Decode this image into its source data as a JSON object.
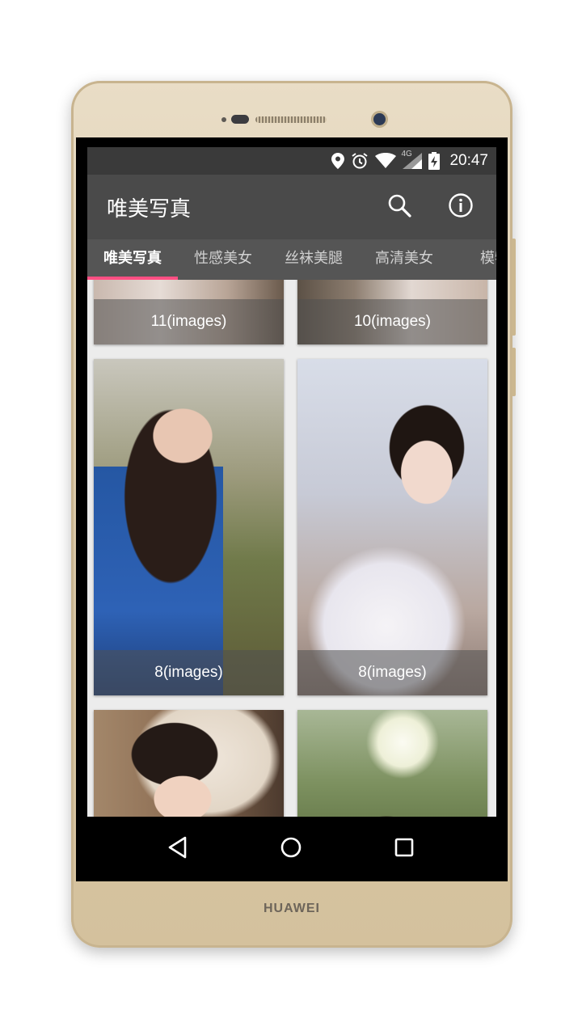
{
  "status_bar": {
    "time": "20:47",
    "network": "4G",
    "icons": [
      "location-icon",
      "alarm-icon",
      "wifi-icon",
      "signal-icon",
      "battery-icon"
    ]
  },
  "toolbar": {
    "title": "唯美写真",
    "actions": [
      "search-icon",
      "info-icon"
    ]
  },
  "tabs": [
    {
      "label": "唯美写真",
      "active": true
    },
    {
      "label": "性感美女",
      "active": false
    },
    {
      "label": "丝袜美腿",
      "active": false
    },
    {
      "label": "高清美女",
      "active": false
    },
    {
      "label": "模特",
      "active": false
    }
  ],
  "albums": [
    {
      "caption": "11(images)"
    },
    {
      "caption": "10(images)"
    },
    {
      "caption": "8(images)"
    },
    {
      "caption": "8(images)"
    },
    {
      "caption": ""
    },
    {
      "caption": ""
    }
  ],
  "nav_bar": [
    "back-icon",
    "home-icon",
    "recents-icon"
  ],
  "device_brand": "HUAWEI",
  "colors": {
    "tab_indicator": "#ff4f83",
    "toolbar": "#4a4a4a",
    "tabs_bg": "#555555"
  }
}
